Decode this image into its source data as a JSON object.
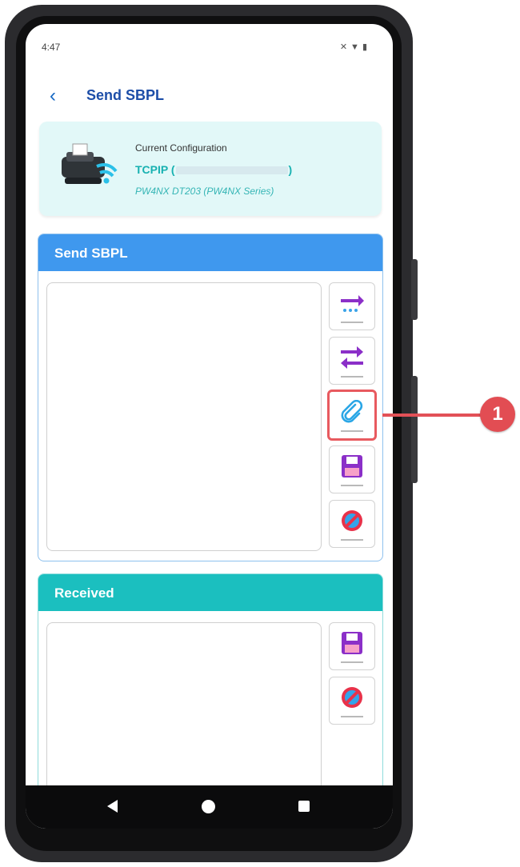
{
  "status_bar": {
    "time": "4:47",
    "icons": [
      "mute-icon",
      "wifi-icon",
      "battery-icon"
    ]
  },
  "header": {
    "back_icon": "chevron-left-icon",
    "title": "Send SBPL"
  },
  "config": {
    "label": "Current Configuration",
    "connection_prefix": "TCPIP (",
    "connection_suffix": ")",
    "model": "PW4NX DT203 (PW4NX Series)"
  },
  "send_panel": {
    "title": "Send SBPL",
    "text_value": "",
    "tools": [
      "send-icon",
      "send-receive-icon",
      "attach-file-icon",
      "save-icon",
      "clear-icon"
    ]
  },
  "received_panel": {
    "title": "Received",
    "text_value": "",
    "tools": [
      "save-icon",
      "clear-icon"
    ]
  },
  "callout": {
    "number": "1"
  },
  "colors": {
    "primary_blue": "#3f98ee",
    "teal": "#1bbfbf",
    "callout_red": "#e24d53",
    "title_blue": "#1d4ea8"
  }
}
